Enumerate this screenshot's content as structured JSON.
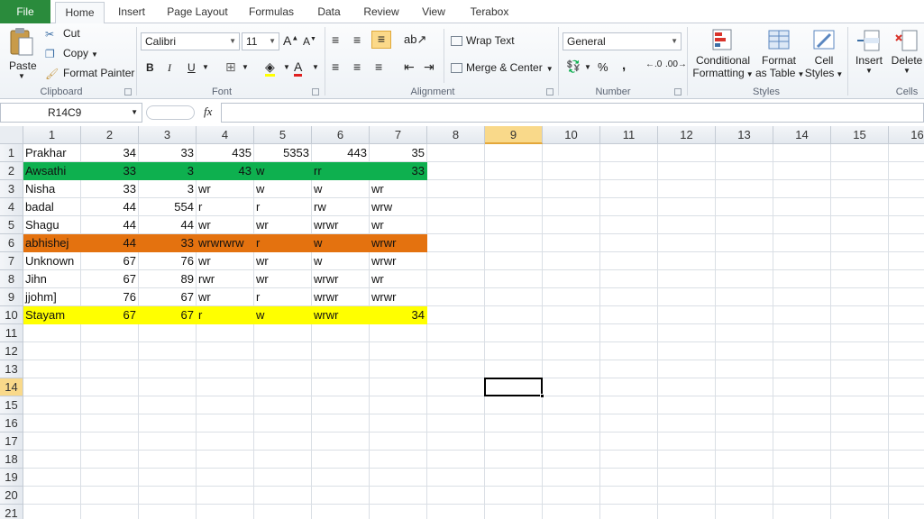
{
  "tabs": {
    "file": "File",
    "items": [
      "Home",
      "Insert",
      "Page Layout",
      "Formulas",
      "Data",
      "Review",
      "View",
      "Terabox"
    ]
  },
  "ribbon": {
    "clipboard": {
      "paste": "Paste",
      "cut": "Cut",
      "copy": "Copy",
      "format_painter": "Format Painter",
      "label": "Clipboard"
    },
    "font": {
      "name": "Calibri",
      "size": "11",
      "bold": "B",
      "italic": "I",
      "underline": "U",
      "label": "Font"
    },
    "alignment": {
      "wrap_text": "Wrap Text",
      "merge_center": "Merge & Center",
      "label": "Alignment"
    },
    "number": {
      "format": "General",
      "percent": "%",
      "comma": ",",
      "label": "Number"
    },
    "styles": {
      "conditional": "Conditional",
      "conditional2": "Formatting",
      "format_table": "Format",
      "format_table2": "as Table",
      "cell_styles": "Cell",
      "cell_styles2": "Styles",
      "label": "Styles"
    },
    "cells": {
      "insert": "Insert",
      "delete": "Delete",
      "label": "Cells"
    }
  },
  "formula_bar": {
    "name_box": "R14C9",
    "fx": "fx",
    "formula": ""
  },
  "columns": [
    "1",
    "2",
    "3",
    "4",
    "5",
    "6",
    "7",
    "8",
    "9",
    "10",
    "11",
    "12",
    "13",
    "14",
    "15",
    "16"
  ],
  "rows": [
    "1",
    "2",
    "3",
    "4",
    "5",
    "6",
    "7",
    "8",
    "9",
    "10",
    "11",
    "12",
    "13",
    "14",
    "15",
    "16",
    "17",
    "18",
    "19",
    "20",
    "21"
  ],
  "selected": {
    "column": "9",
    "row": "14"
  },
  "colors": {
    "green_row": "#0eb04f",
    "orange_row": "#e4720f",
    "yellow_row": "#ffff00",
    "accent": "#2a8b3c"
  },
  "cells": [
    [
      "Prakhar",
      "34",
      "33",
      "435",
      "5353",
      "443",
      "35"
    ],
    [
      "Awsathi",
      "33",
      "3",
      "43",
      "w",
      "rr",
      "33"
    ],
    [
      "Nisha",
      "33",
      "3",
      "wr",
      "w",
      "w",
      "wr"
    ],
    [
      "badal",
      "44",
      "554",
      "r",
      "r",
      "rw",
      "wrw"
    ],
    [
      "Shagu",
      "44",
      "44",
      "wr",
      "wr",
      "wrwr",
      "wr"
    ],
    [
      "abhishej",
      "44",
      "33",
      "wrwrwrw",
      "r",
      "w",
      "wrwr"
    ],
    [
      "Unknown",
      "67",
      "76",
      "wr",
      "wr",
      "w",
      "wrwr"
    ],
    [
      "Jihn",
      "67",
      "89",
      "rwr",
      "wr",
      "wrwr",
      "wr"
    ],
    [
      "jjohm]",
      "76",
      "67",
      "wr",
      "r",
      "wrwr",
      "wrwr"
    ],
    [
      "Stayam",
      "67",
      "67",
      "r",
      "w",
      "wrwr",
      "34"
    ]
  ]
}
